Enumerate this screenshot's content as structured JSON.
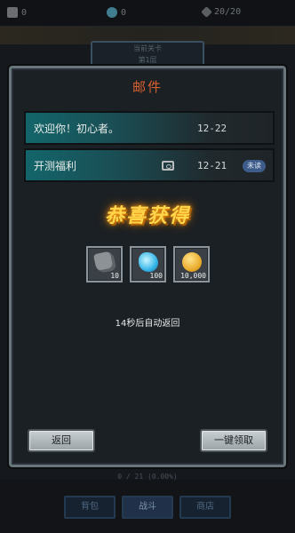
{
  "background": {
    "resources": [
      {
        "icon": "stone-resource-icon",
        "value": "0"
      },
      {
        "icon": "crystal-resource-icon",
        "value": "0"
      },
      {
        "icon": "energy-resource-icon",
        "value": "20/20"
      }
    ],
    "stage_label": "当前关卡",
    "stage_sub": "第1层",
    "floor_text": "0 / 21 (0.00%)",
    "nav_tabs": [
      "背包",
      "战斗",
      "商店"
    ]
  },
  "mail_dialog": {
    "title": "邮件",
    "items": [
      {
        "subject": "欢迎你！初心者。",
        "date": "12-22",
        "has_attachment": false,
        "badge": ""
      },
      {
        "subject": "开测福利",
        "date": "12-21",
        "has_attachment": true,
        "badge": "未读"
      }
    ],
    "reward_banner": "恭喜获得",
    "rewards": [
      {
        "icon": "stone-icon",
        "quantity": "10"
      },
      {
        "icon": "blue-crystal-icon",
        "quantity": "100"
      },
      {
        "icon": "gold-coin-icon",
        "quantity": "10,000"
      }
    ],
    "countdown_text": "14秒后自动返回",
    "buttons": {
      "back": "返回",
      "claim_all": "一键领取"
    }
  },
  "colors": {
    "title_accent": "#d9602e",
    "banner_gold": "#ffd54a",
    "mail_teal": "#12656a"
  }
}
